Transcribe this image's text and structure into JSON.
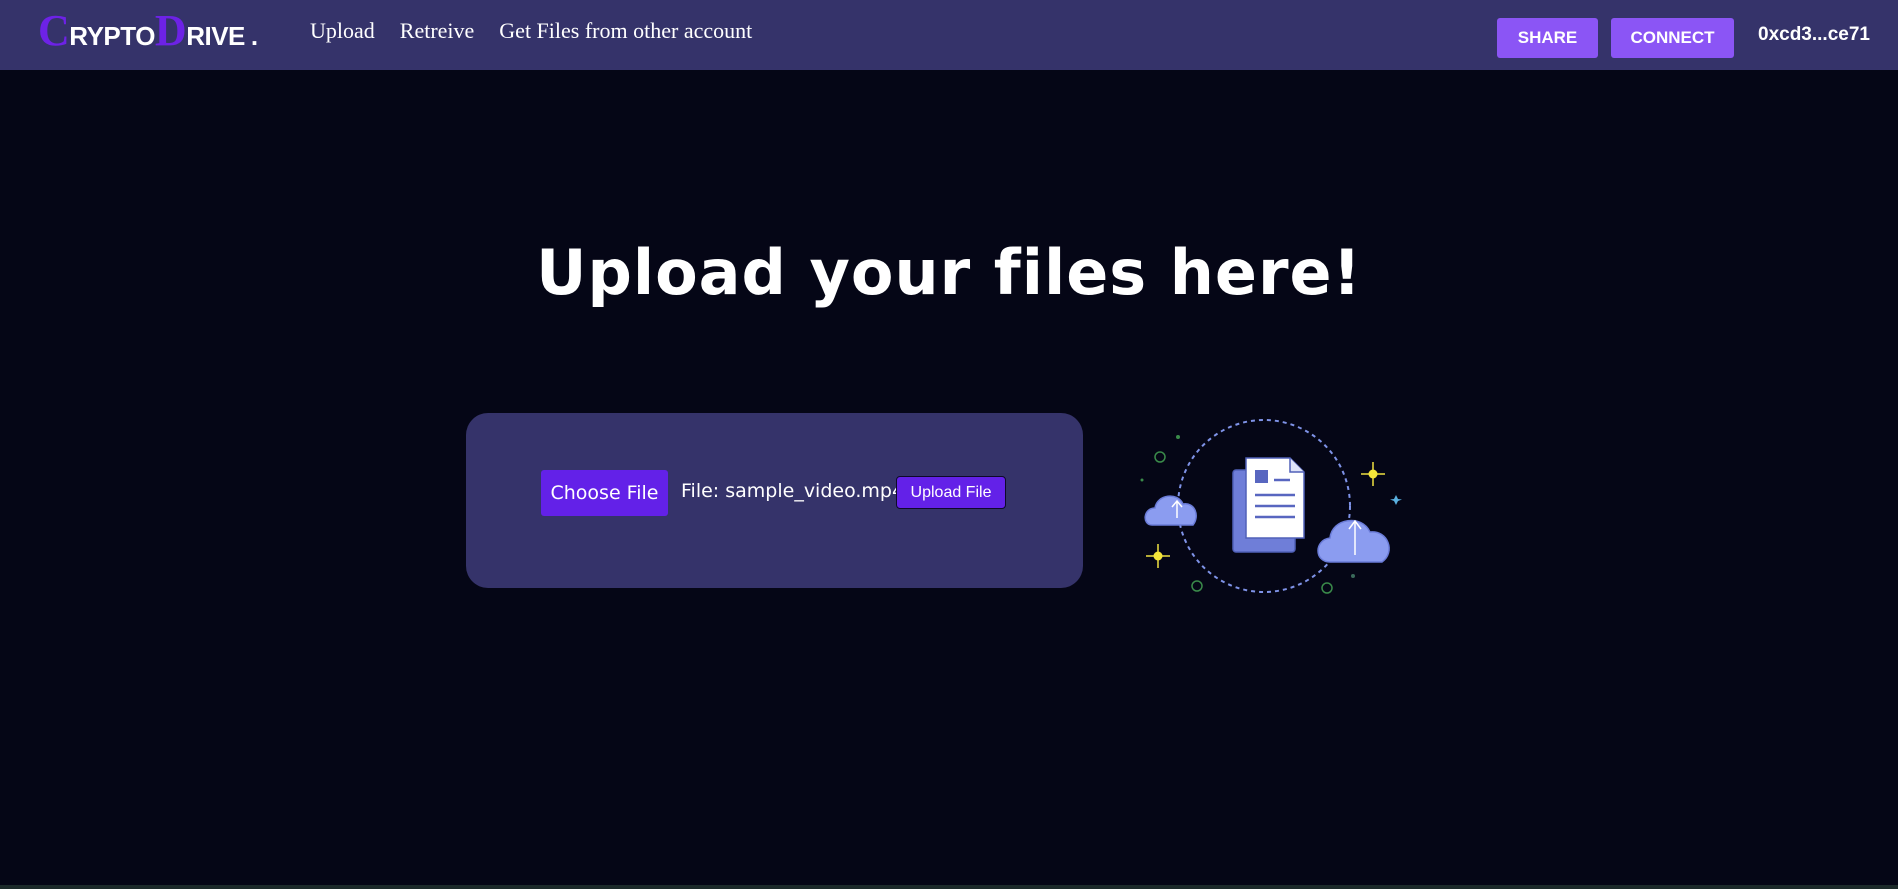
{
  "brand": {
    "first_cap": "C",
    "first_rest": "RYPTO",
    "second_cap": "D",
    "second_rest": "RIVE",
    "dot": ".",
    "accent_color": "#6d22e6"
  },
  "nav": {
    "links": [
      "Upload",
      "Retreive",
      "Get Files from other account"
    ]
  },
  "header_actions": {
    "share_label": "SHARE",
    "connect_label": "CONNECT",
    "wallet_address": "0xcd3...ce71",
    "button_color": "#8b55f5"
  },
  "main": {
    "heading": "Upload your files here!",
    "choose_file_label": "Choose File",
    "file_label": "File: sample_video.mp4",
    "upload_button_label": "Upload File",
    "card_color": "#35336a",
    "primary_color": "#6321e8"
  },
  "illustration": {
    "icons": [
      "cloud-upload-icon",
      "document-icon",
      "sparkle-icon"
    ]
  }
}
